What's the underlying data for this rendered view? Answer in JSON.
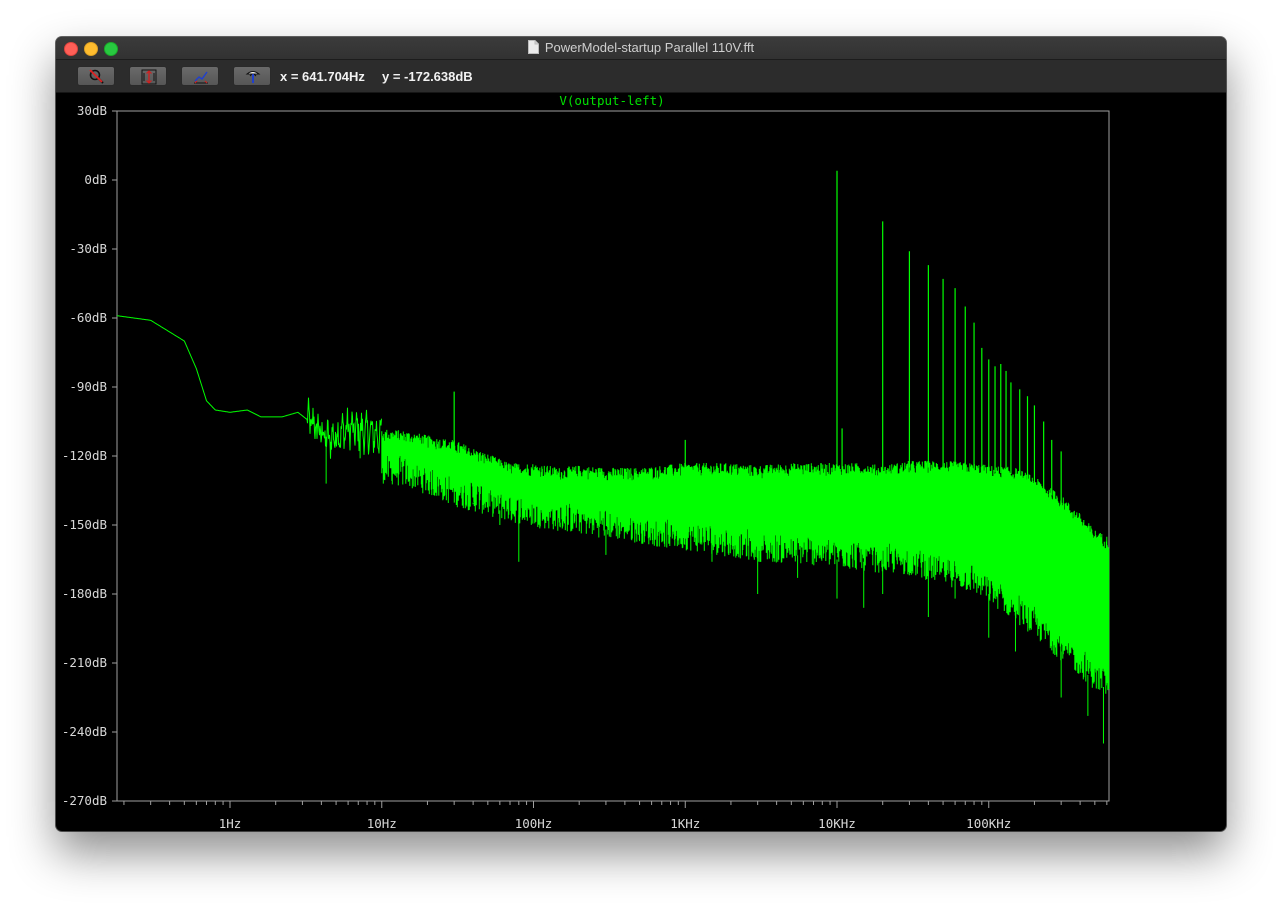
{
  "window": {
    "title": "PowerModel-startup Parallel 110V.fft"
  },
  "toolbar": {
    "buttons": [
      {
        "name": "zoom-cancel-button",
        "icon": "zoom-cancel-icon"
      },
      {
        "name": "autorange-y-button",
        "icon": "autorange-y-icon"
      },
      {
        "name": "autorange-x-button",
        "icon": "autorange-x-icon"
      },
      {
        "name": "probe-tool-button",
        "icon": "probe-icon"
      }
    ],
    "cursor_x": "x = 641.704Hz",
    "cursor_y": "y = -172.638dB"
  },
  "colors": {
    "trace": "#00ff00",
    "trace_title": "#00e000",
    "plot_background": "#000000",
    "axis": "#a0a0a0",
    "tick_label": "#d8d8d8"
  },
  "chart_data": {
    "type": "line",
    "title": "V(output-left)",
    "xscale": "log",
    "xlim": [
      0.18,
      620000
    ],
    "ylim": [
      -270,
      30
    ],
    "y_ticks": [
      30,
      0,
      -30,
      -60,
      -90,
      -120,
      -150,
      -180,
      -210,
      -240,
      -270
    ],
    "y_tick_labels": [
      "30dB",
      "0dB",
      "-30dB",
      "-60dB",
      "-90dB",
      "-120dB",
      "-150dB",
      "-180dB",
      "-210dB",
      "-240dB",
      "-270dB"
    ],
    "x_ticks": [
      1,
      10,
      100,
      1000,
      10000,
      100000
    ],
    "x_tick_labels": [
      "1Hz",
      "10Hz",
      "100Hz",
      "1KHz",
      "10KHz",
      "100KHz"
    ],
    "grid": false,
    "series": [
      {
        "name": "V(output-left)",
        "envelope_upper": [
          [
            0.18,
            -59
          ],
          [
            0.3,
            -61
          ],
          [
            0.5,
            -70
          ],
          [
            0.6,
            -82
          ],
          [
            0.7,
            -96
          ],
          [
            0.8,
            -100
          ],
          [
            1.0,
            -101
          ],
          [
            1.3,
            -100
          ],
          [
            1.6,
            -103
          ],
          [
            2.2,
            -103
          ],
          [
            2.8,
            -101
          ],
          [
            3.5,
            -106
          ],
          [
            4.5,
            -113
          ],
          [
            6,
            -108
          ],
          [
            8,
            -110
          ],
          [
            10,
            -111
          ],
          [
            15,
            -112
          ],
          [
            20,
            -114
          ],
          [
            30,
            -116
          ],
          [
            50,
            -122
          ],
          [
            70,
            -126
          ],
          [
            100,
            -126
          ],
          [
            150,
            -128
          ],
          [
            200,
            -127
          ],
          [
            300,
            -128
          ],
          [
            500,
            -128
          ],
          [
            700,
            -127
          ],
          [
            1000,
            -126
          ],
          [
            2000,
            -126
          ],
          [
            3000,
            -127
          ],
          [
            5000,
            -126
          ],
          [
            8000,
            -126
          ],
          [
            10000,
            -126
          ],
          [
            15000,
            -126
          ],
          [
            20000,
            -127
          ],
          [
            30000,
            -125
          ],
          [
            50000,
            -125
          ],
          [
            80000,
            -126
          ],
          [
            100000,
            -127
          ],
          [
            150000,
            -128
          ],
          [
            200000,
            -132
          ],
          [
            300000,
            -140
          ],
          [
            400000,
            -148
          ],
          [
            500000,
            -155
          ],
          [
            620000,
            -158
          ]
        ],
        "envelope_lower": [
          [
            10,
            -128
          ],
          [
            15,
            -130
          ],
          [
            20,
            -133
          ],
          [
            30,
            -138
          ],
          [
            50,
            -142
          ],
          [
            70,
            -145
          ],
          [
            100,
            -147
          ],
          [
            150,
            -149
          ],
          [
            200,
            -150
          ],
          [
            300,
            -152
          ],
          [
            500,
            -154
          ],
          [
            700,
            -156
          ],
          [
            1000,
            -157
          ],
          [
            2000,
            -160
          ],
          [
            3000,
            -162
          ],
          [
            5000,
            -163
          ],
          [
            8000,
            -164
          ],
          [
            10000,
            -165
          ],
          [
            15000,
            -166
          ],
          [
            20000,
            -167
          ],
          [
            30000,
            -168
          ],
          [
            50000,
            -172
          ],
          [
            80000,
            -176
          ],
          [
            100000,
            -180
          ],
          [
            150000,
            -188
          ],
          [
            200000,
            -195
          ],
          [
            300000,
            -205
          ],
          [
            400000,
            -212
          ],
          [
            500000,
            -218
          ],
          [
            620000,
            -222
          ]
        ],
        "peaks": [
          [
            30,
            -92
          ],
          [
            1000,
            -113
          ],
          [
            10000,
            4
          ],
          [
            10800,
            -108
          ],
          [
            20000,
            -18
          ],
          [
            30000,
            -31
          ],
          [
            40000,
            -37
          ],
          [
            50000,
            -43
          ],
          [
            60000,
            -47
          ],
          [
            70000,
            -55
          ],
          [
            80000,
            -62
          ],
          [
            90000,
            -73
          ],
          [
            100000,
            -78
          ],
          [
            110000,
            -81
          ],
          [
            120000,
            -80
          ],
          [
            130000,
            -83
          ],
          [
            140000,
            -88
          ],
          [
            160000,
            -91
          ],
          [
            180000,
            -94
          ],
          [
            200000,
            -98
          ],
          [
            230000,
            -105
          ],
          [
            260000,
            -113
          ],
          [
            300000,
            -118
          ]
        ],
        "dips": [
          [
            4.3,
            -132
          ],
          [
            7.2,
            -121
          ],
          [
            40,
            -141
          ],
          [
            60,
            -150
          ],
          [
            80,
            -166
          ],
          [
            150,
            -151
          ],
          [
            300,
            -163
          ],
          [
            500,
            -157
          ],
          [
            1500,
            -166
          ],
          [
            3000,
            -180
          ],
          [
            5500,
            -173
          ],
          [
            10000,
            -182
          ],
          [
            15000,
            -186
          ],
          [
            20000,
            -180
          ],
          [
            40000,
            -190
          ],
          [
            60000,
            -182
          ],
          [
            100000,
            -199
          ],
          [
            150000,
            -205
          ],
          [
            300000,
            -225
          ],
          [
            450000,
            -233
          ],
          [
            570000,
            -245
          ]
        ]
      }
    ]
  }
}
